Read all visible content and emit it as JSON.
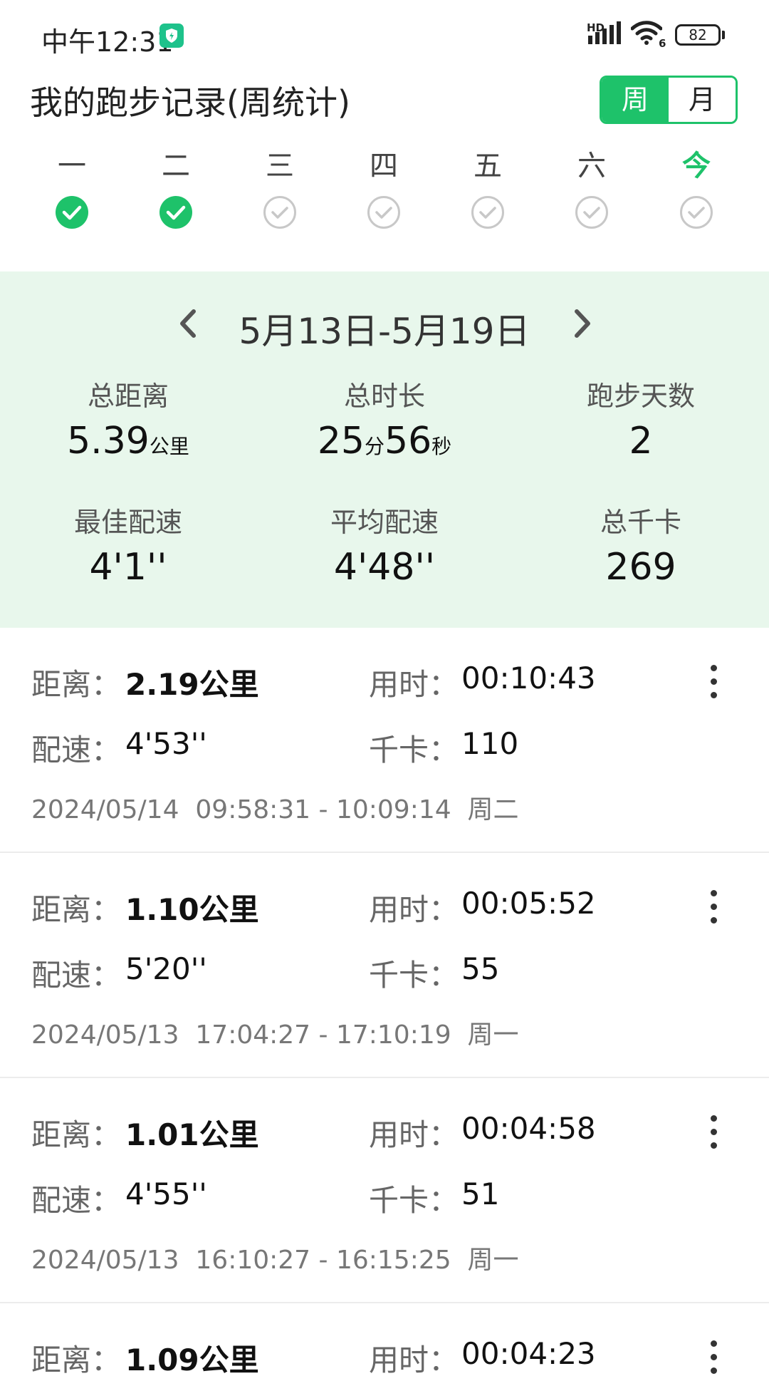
{
  "status_bar": {
    "time": "中午12:31",
    "battery": "82",
    "signal_label": "HD",
    "wifi_label": "6",
    "icons": [
      "shield-icon",
      "signal-icon",
      "wifi-icon",
      "battery-icon"
    ]
  },
  "header": {
    "title": "我的跑步记录(周统计)",
    "toggle": {
      "week": "周",
      "month": "月",
      "selected": "week"
    }
  },
  "week_days": [
    {
      "label": "一",
      "checked": true,
      "today": false
    },
    {
      "label": "二",
      "checked": true,
      "today": false
    },
    {
      "label": "三",
      "checked": false,
      "today": false
    },
    {
      "label": "四",
      "checked": false,
      "today": false
    },
    {
      "label": "五",
      "checked": false,
      "today": false
    },
    {
      "label": "六",
      "checked": false,
      "today": false
    },
    {
      "label": "今",
      "checked": false,
      "today": true
    }
  ],
  "summary": {
    "range": "5月13日-5月19日",
    "total_distance": {
      "label": "总距离",
      "value": "5.39",
      "unit": "公里"
    },
    "total_time": {
      "label": "总时长",
      "minutes": "25",
      "min_unit": "分",
      "seconds": "56",
      "sec_unit": "秒"
    },
    "run_days": {
      "label": "跑步天数",
      "value": "2"
    },
    "best_pace": {
      "label": "最佳配速",
      "value": "4'1''"
    },
    "avg_pace": {
      "label": "平均配速",
      "value": "4'48''"
    },
    "total_kcal": {
      "label": "总千卡",
      "value": "269"
    }
  },
  "labels": {
    "distance": "距离：",
    "duration": "用时：",
    "pace": "配速：",
    "kcal": "千卡："
  },
  "records": [
    {
      "distance": "2.19公里",
      "duration": "00:10:43",
      "pace": "4'53''",
      "kcal": "110",
      "date": "2024/05/14",
      "time_range": "09:58:31 - 10:09:14",
      "weekday": "周二"
    },
    {
      "distance": "1.10公里",
      "duration": "00:05:52",
      "pace": "5'20''",
      "kcal": "55",
      "date": "2024/05/13",
      "time_range": "17:04:27 - 17:10:19",
      "weekday": "周一"
    },
    {
      "distance": "1.01公里",
      "duration": "00:04:58",
      "pace": "4'55''",
      "kcal": "51",
      "date": "2024/05/13",
      "time_range": "16:10:27 - 16:15:25",
      "weekday": "周一"
    },
    {
      "distance": "1.09公里",
      "duration": "00:04:23"
    }
  ],
  "colors": {
    "accent": "#1ec26a",
    "summary_bg": "#e8f7ec"
  }
}
